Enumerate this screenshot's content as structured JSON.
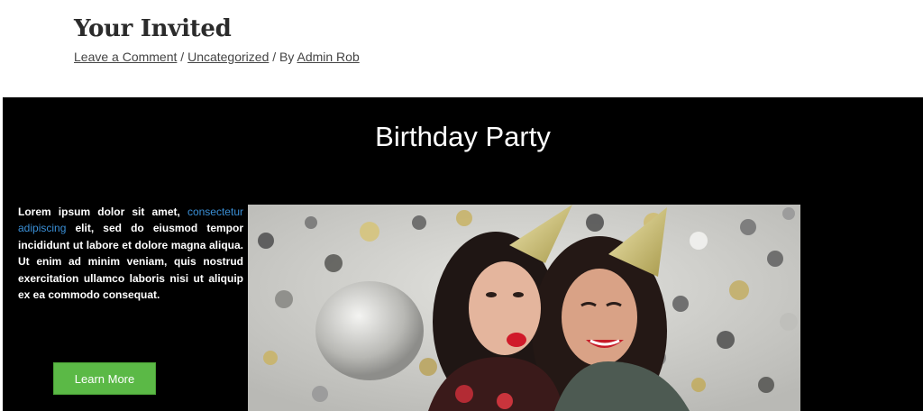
{
  "post": {
    "title": "Your Invited",
    "meta": {
      "comment_link": "Leave a Comment",
      "sep1": " / ",
      "category_link": "Uncategorized",
      "by_text": " / By ",
      "author_link": "Admin Rob"
    }
  },
  "hero": {
    "title": "Birthday Party",
    "text_part1": "Lorem ipsum dolor sit amet, ",
    "text_link": "consectetur adipiscing",
    "text_part2": " elit, sed do eiusmod tempor incididunt ut labore et dolore magna aliqua. Ut enim ad minim veniam, quis nostrud exercitation ullamco laboris nisi ut aliquip ex ea commodo consequat.",
    "button_label": "Learn More",
    "button_color": "#5bb946",
    "link_color": "#3a8fd6",
    "image_icon": "party-photo"
  }
}
